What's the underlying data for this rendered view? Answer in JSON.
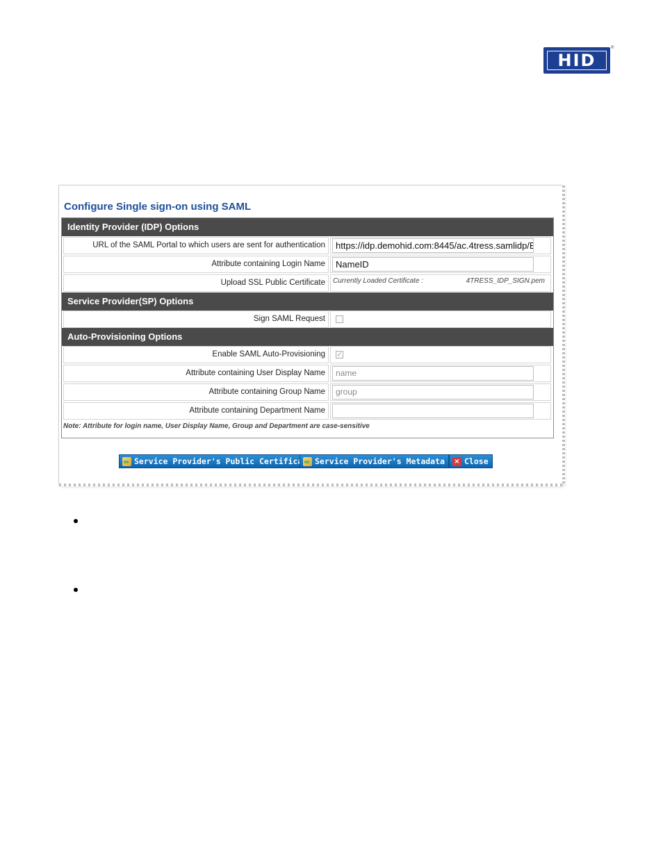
{
  "logo": {
    "text": "HID",
    "reg": "®"
  },
  "form": {
    "title": "Configure Single sign-on using SAML",
    "idp_header": "Identity Provider (IDP) Options",
    "sp_header": "Service Provider(SP) Options",
    "auto_header": "Auto-Provisioning Options",
    "rows": {
      "saml_url_label": "URL of the SAML Portal to which users are sent for authentication",
      "saml_url_value": "https://idp.demohid.com:8445/ac.4tress.samlidp/E",
      "login_name_label": "Attribute containing Login Name",
      "login_name_value": "NameID",
      "ssl_cert_label": "Upload SSL Public Certificate",
      "ssl_cert_note": "Currently Loaded Certificate :",
      "ssl_cert_file": "4TRESS_IDP_SIGN.pem",
      "sign_request_label": "Sign SAML Request",
      "sign_request_checked": false,
      "enable_auto_label": "Enable SAML Auto-Provisioning",
      "enable_auto_checked": true,
      "display_name_label": "Attribute containing User Display Name",
      "display_name_placeholder": "name",
      "group_name_label": "Attribute containing Group Name",
      "group_name_placeholder": "group",
      "department_label": "Attribute containing Department Name",
      "department_value": ""
    },
    "note": "Note: Attribute for login name, User Display Name, Group and Department are case-sensitive"
  },
  "buttons": {
    "public_cert": "Service Provider's Public Certificate",
    "metadata": "Service Provider's Metadata",
    "close": "Close"
  },
  "icons": {
    "public_cert": "certificate-icon",
    "metadata": "certificate-icon",
    "close": "close-icon"
  },
  "colors": {
    "brand": "#1c3f94",
    "title": "#1f4e9a",
    "section_header": "#4a4a4a",
    "button": "#1a78c4"
  }
}
